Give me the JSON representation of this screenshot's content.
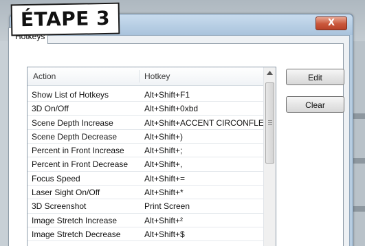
{
  "badge": {
    "text": "ÉTAPE 3"
  },
  "window": {
    "close_label": "X"
  },
  "tab": {
    "label": "Hotkeys"
  },
  "table": {
    "headers": {
      "action": "Action",
      "hotkey": "Hotkey"
    },
    "rows": [
      {
        "action": "Show List of Hotkeys",
        "hotkey": "Alt+Shift+F1"
      },
      {
        "action": "3D On/Off",
        "hotkey": "Alt+Shift+0xbd"
      },
      {
        "action": "Scene Depth Increase",
        "hotkey": "Alt+Shift+ACCENT CIRCONFLEXE"
      },
      {
        "action": "Scene Depth Decrease",
        "hotkey": "Alt+Shift+)"
      },
      {
        "action": "Percent in Front Increase",
        "hotkey": "Alt+Shift+;"
      },
      {
        "action": "Percent in Front Decrease",
        "hotkey": "Alt+Shift+,"
      },
      {
        "action": "Focus Speed",
        "hotkey": "Alt+Shift+="
      },
      {
        "action": "Laser Sight On/Off",
        "hotkey": "Alt+Shift+*"
      },
      {
        "action": "3D Screenshot",
        "hotkey": "Print Screen"
      },
      {
        "action": "Image Stretch Increase",
        "hotkey": "Alt+Shift+²"
      },
      {
        "action": "Image Stretch Decrease",
        "hotkey": "Alt+Shift+$"
      }
    ]
  },
  "buttons": {
    "edit": "Edit",
    "clear": "Clear"
  },
  "icons": {
    "scroll_up": "chevron-up-icon",
    "close": "close-icon"
  }
}
